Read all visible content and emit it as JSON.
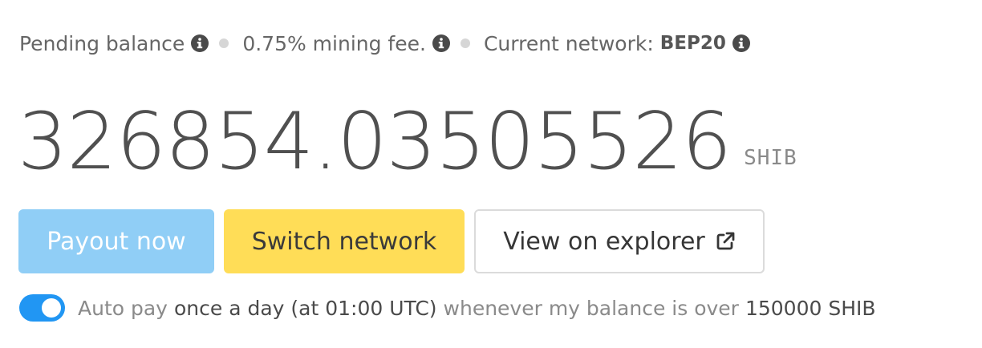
{
  "info": {
    "pending_label": "Pending balance",
    "fee_label": "0.75% mining fee.",
    "network_label": "Current network:",
    "network_value": "BEP20"
  },
  "balance": {
    "amount": "326854.03505526",
    "unit": "SHIB"
  },
  "buttons": {
    "payout": "Payout now",
    "switch": "Switch network",
    "explorer": "View on explorer"
  },
  "autopay": {
    "enabled": true,
    "prefix": "Auto pay",
    "frequency": "once a day (at 01:00 UTC)",
    "middle": "whenever my balance is over",
    "threshold": "150000 SHIB"
  },
  "icons": {
    "info": "info-circle-icon",
    "external": "external-link-icon"
  },
  "colors": {
    "payout_bg": "#90cef6",
    "switch_bg": "#ffdd57",
    "toggle_on": "#2196f3"
  }
}
